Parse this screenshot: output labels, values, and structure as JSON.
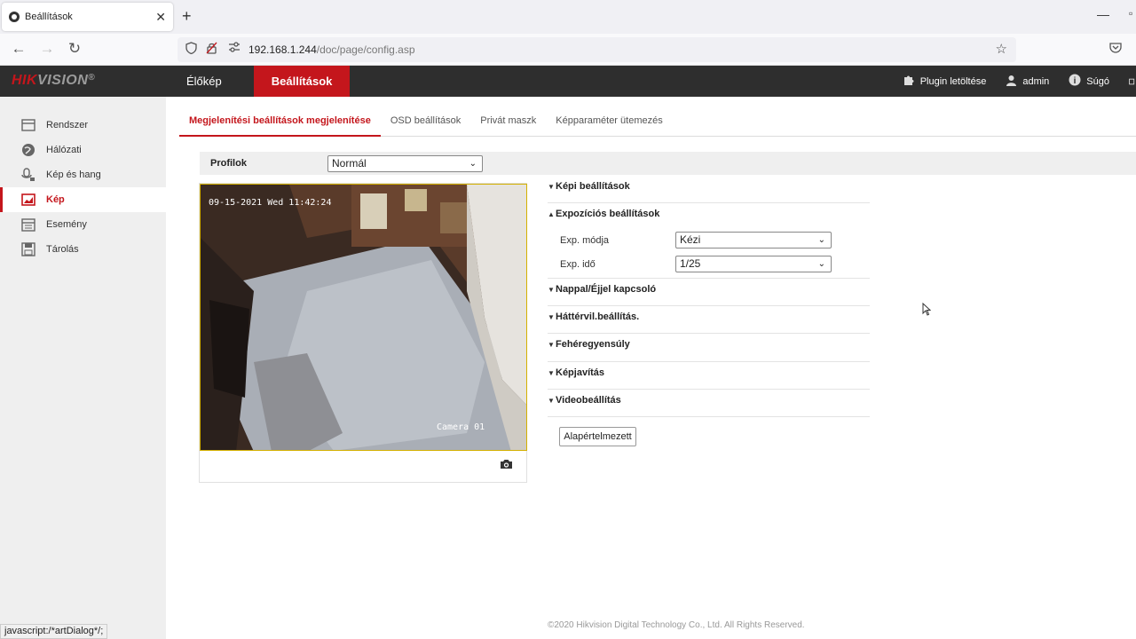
{
  "browser": {
    "tab_title": "Beállítások",
    "url_host": "192.168.1.244",
    "url_path": "/doc/page/config.asp",
    "status_text": "javascript:/*artDialog*/;"
  },
  "header": {
    "logo_part1": "HIK",
    "logo_part2": "VISION",
    "logo_reg": "®",
    "nav": [
      {
        "label": "Élőkép"
      },
      {
        "label": "Beállítások"
      }
    ],
    "plugin_label": "Plugin letöltése",
    "user_label": "admin",
    "help_label": "Súgó"
  },
  "sidebar": {
    "items": [
      {
        "label": "Rendszer",
        "icon": "system-icon"
      },
      {
        "label": "Hálózati",
        "icon": "network-icon"
      },
      {
        "label": "Kép és hang",
        "icon": "video-audio-icon"
      },
      {
        "label": "Kép",
        "icon": "image-icon",
        "active": true
      },
      {
        "label": "Esemény",
        "icon": "event-icon"
      },
      {
        "label": "Tárolás",
        "icon": "storage-icon"
      }
    ]
  },
  "subtabs": [
    {
      "label": "Megjelenítési beállítások megjelenítése",
      "active": true
    },
    {
      "label": "OSD beállítások"
    },
    {
      "label": "Privát maszk"
    },
    {
      "label": "Képparaméter ütemezés"
    }
  ],
  "profile": {
    "label": "Profilok",
    "value": "Normál"
  },
  "video": {
    "timestamp": "09-15-2021 Wed 11:42:24",
    "camera_name": "Camera 01"
  },
  "sections": {
    "image": "Képi beállítások",
    "exposure": "Expozíciós beállítások",
    "exp_mode_label": "Exp. módja",
    "exp_mode_value": "Kézi",
    "exp_time_label": "Exp. idő",
    "exp_time_value": "1/25",
    "daynight": "Nappal/Éjjel kapcsoló",
    "backlight": "Háttérvil.beállítás.",
    "whitebalance": "Fehéregyensúly",
    "enhancement": "Képjavítás",
    "video": "Videobeállítás",
    "default_button": "Alapértelmezett"
  },
  "footer": "©2020 Hikvision Digital Technology Co., Ltd. All Rights Reserved.",
  "colors": {
    "brand_red": "#c4161c",
    "header_bg": "#2e2e2e"
  }
}
